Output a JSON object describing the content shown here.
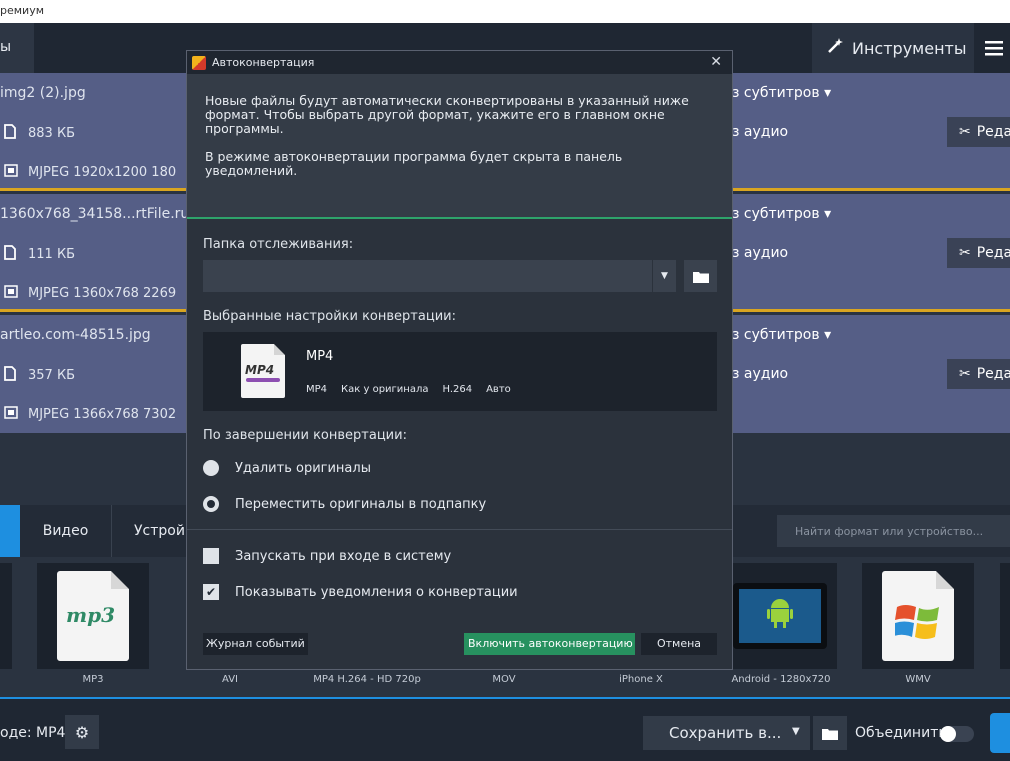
{
  "window": {
    "title": "ремиум"
  },
  "topbar": {
    "left_tab": "ы",
    "tools_label": "Инструменты",
    "tools_icon": "magic-wand-icon",
    "menu_icon": "hamburger-menu-icon"
  },
  "files": [
    {
      "name": "img2 (2).jpg",
      "size": "883 КБ",
      "codec": "MJPEG 1920x1200 180",
      "subs": "з субтитров ▾",
      "audio": "з аудио",
      "edit": "Реда"
    },
    {
      "name": "1360x768_34158...rtFile.ru",
      "size": "111 КБ",
      "codec": "MJPEG 1360x768 2269",
      "subs": "з субтитров ▾",
      "audio": "з аудио",
      "edit": "Реда"
    },
    {
      "name": "artleo.com-48515.jpg",
      "size": "357 КБ",
      "codec": "MJPEG 1366x768 7302",
      "subs": "з субтитров ▾",
      "audio": "з аудио",
      "edit": "Реда"
    }
  ],
  "format_tabs": {
    "video": "Видео",
    "devices": "Устрой",
    "search_placeholder": "Найти формат или устройство..."
  },
  "tiles": [
    {
      "label": ""
    },
    {
      "label": "MP3",
      "text": "mp3"
    },
    {
      "label": "AVI"
    },
    {
      "label": "MP4 H.264 - HD 720p"
    },
    {
      "label": "MOV"
    },
    {
      "label": "iPhone X"
    },
    {
      "label": "Android - 1280x720"
    },
    {
      "label": "WMV"
    }
  ],
  "bottom": {
    "output_label": "оде: MP4",
    "save_label": "Сохранить в...",
    "merge_label": "Объединить"
  },
  "dialog": {
    "title": "Автоконвертация",
    "close": "✕",
    "info_1": "Новые файлы будут автоматически сконвертированы в указанный ниже формат. Чтобы выбрать другой формат, укажите его в главном окне программы.",
    "info_2": "В режиме автоконвертации программа будет скрыта в панель уведомлений.",
    "watch_folder_label": "Папка отслеживания:",
    "watch_folder_value": "",
    "settings_label": "Выбранные настройки конвертации:",
    "preset": {
      "icon_text": "MP4",
      "name": "MP4",
      "format": "MP4",
      "resolution": "Как у оригинала",
      "codec": "H.264",
      "quality": "Авто"
    },
    "after_label": "По завершении конвертации:",
    "radio_delete": "Удалить оригиналы",
    "radio_move": "Переместить оригиналы в подпапку",
    "radio_selected": "move",
    "check_startup": "Запускать при входе в систему",
    "check_startup_checked": false,
    "check_notify": "Показывать уведомления о конвертации",
    "check_notify_checked": true,
    "log_button": "Журнал событий",
    "enable_button": "Включить автоконвертацию",
    "cancel_button": "Отмена"
  },
  "colors": {
    "accent_blue": "#1e8fe0",
    "accent_green": "#27915f",
    "file_row_bg": "#555e86",
    "file_divider": "#d9a521"
  }
}
